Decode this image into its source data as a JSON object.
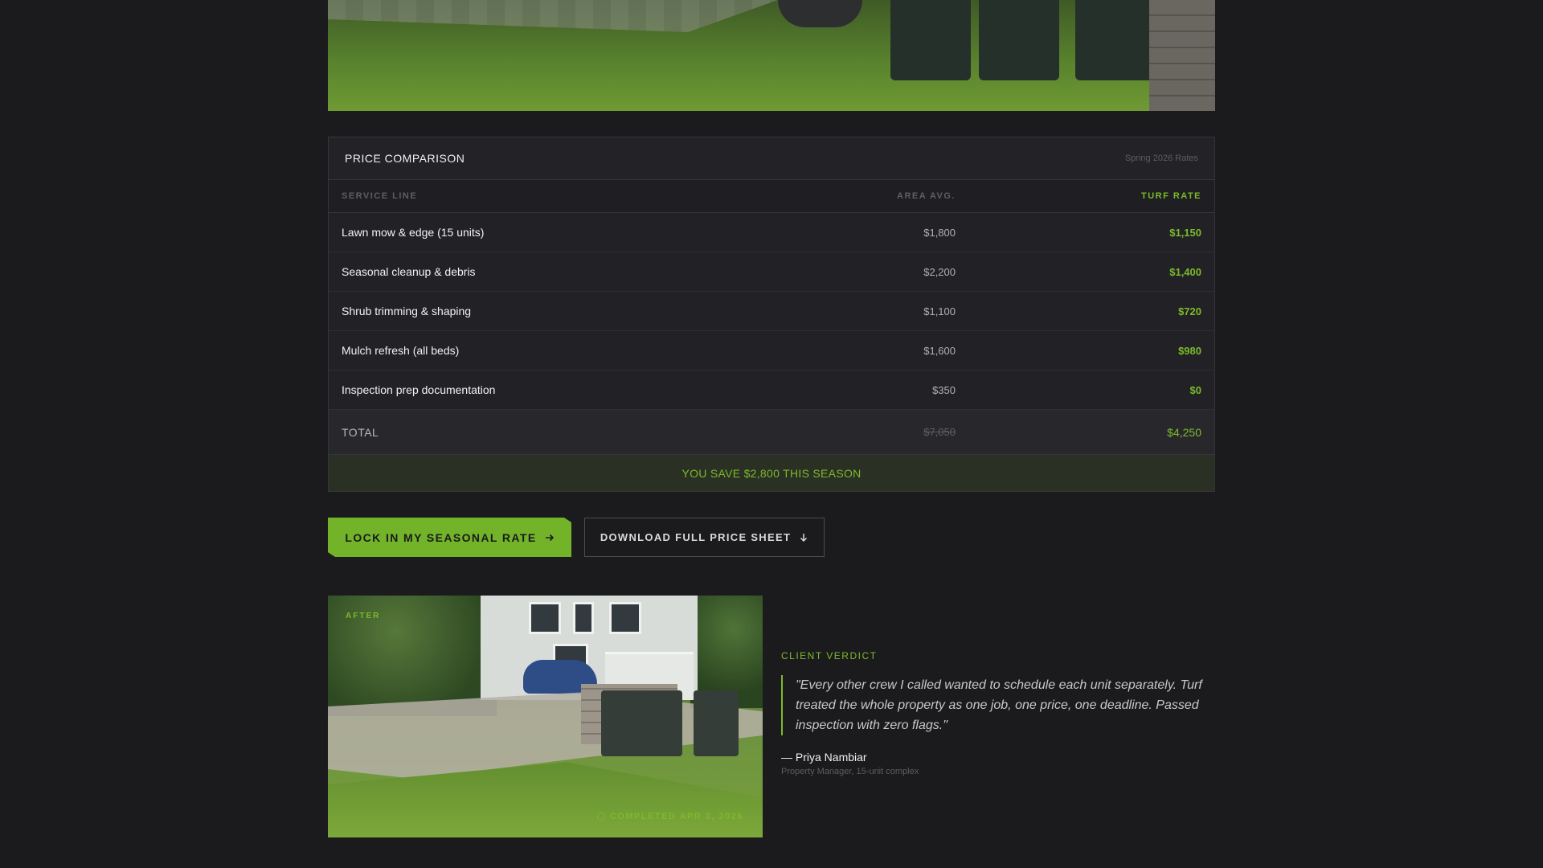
{
  "comparison": {
    "title": "PRICE COMPARISON",
    "subtitle": "Spring 2026 Rates",
    "columns": {
      "service": "SERVICE LINE",
      "area_avg": "AREA AVG.",
      "turf_rate": "TURF RATE"
    },
    "rows": [
      {
        "service": "Lawn mow & edge (15 units)",
        "area_avg": "$1,800",
        "turf_rate": "$1,150"
      },
      {
        "service": "Seasonal cleanup & debris",
        "area_avg": "$2,200",
        "turf_rate": "$1,400"
      },
      {
        "service": "Shrub trimming & shaping",
        "area_avg": "$1,100",
        "turf_rate": "$720"
      },
      {
        "service": "Mulch refresh (all beds)",
        "area_avg": "$1,600",
        "turf_rate": "$980"
      },
      {
        "service": "Inspection prep documentation",
        "area_avg": "$350",
        "turf_rate": "$0"
      }
    ],
    "total": {
      "label": "TOTAL",
      "area_avg": "$7,050",
      "turf_rate": "$4,250"
    },
    "savings": "YOU SAVE $2,800 THIS SEASON"
  },
  "actions": {
    "primary_label": "LOCK IN MY SEASONAL RATE",
    "primary_icon": "arrow-right-icon",
    "secondary_label": "DOWNLOAD FULL PRICE SHEET",
    "secondary_icon": "arrow-down-icon"
  },
  "after_photo": {
    "tag": "AFTER",
    "completed": "COMPLETED APR 3, 2026"
  },
  "testimonial": {
    "kicker": "CLIENT VERDICT",
    "quote": "\"Every other crew I called wanted to schedule each unit separately. Turf treated the whole property as one job, one price, one deadline. Passed inspection with zero flags.\"",
    "author": "— Priya Nambiar",
    "role": "Property Manager, 15-unit complex"
  },
  "colors": {
    "accent": "#7cba2a",
    "background": "#1b1b1e",
    "panel": "#232327"
  }
}
